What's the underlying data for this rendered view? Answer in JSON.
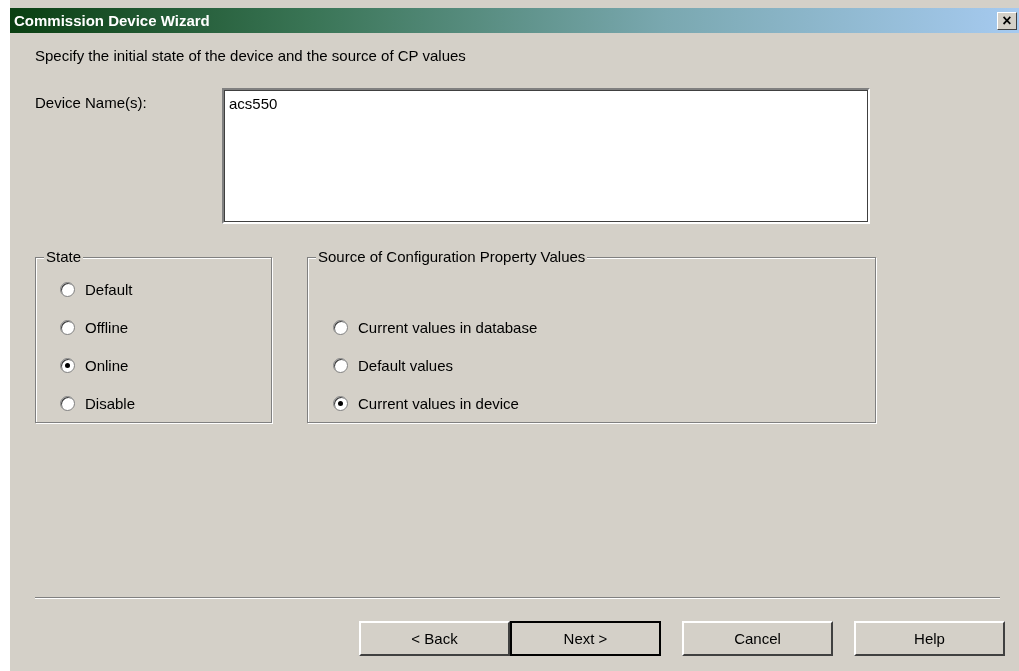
{
  "window": {
    "title": "Commission Device Wizard",
    "close": "×"
  },
  "instruction": "Specify the initial state of the device and the source of CP values",
  "device_names": {
    "label": "Device Name(s):",
    "value": "acs550"
  },
  "state_group": {
    "title": "State",
    "options": [
      {
        "label": "Default",
        "selected": false
      },
      {
        "label": "Offline",
        "selected": false
      },
      {
        "label": "Online",
        "selected": true
      },
      {
        "label": "Disable",
        "selected": false
      }
    ]
  },
  "source_group": {
    "title": "Source of Configuration Property Values",
    "options": [
      {
        "label": "Current values in database",
        "selected": false
      },
      {
        "label": "Default values",
        "selected": false
      },
      {
        "label": "Current values in device",
        "selected": true
      }
    ]
  },
  "buttons": [
    {
      "label": "< Back",
      "default": false
    },
    {
      "label": "Next >",
      "default": true
    },
    {
      "label": "Cancel",
      "default": false
    },
    {
      "label": "Help",
      "default": false
    }
  ]
}
